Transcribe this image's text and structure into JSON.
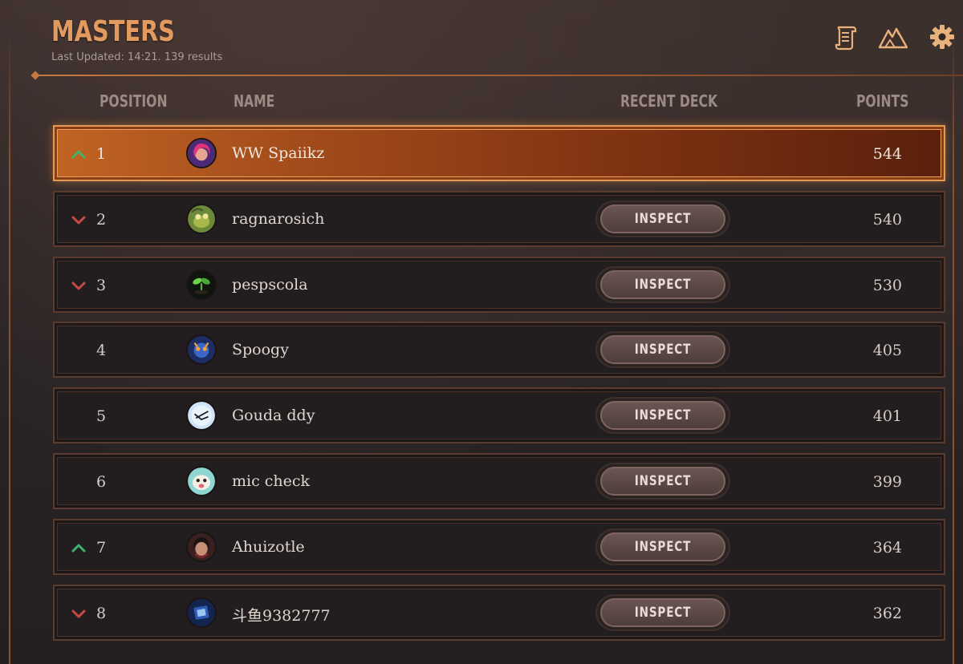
{
  "header": {
    "title": "MASTERS",
    "subtitle": "Last Updated: 14:21. 139 results",
    "icons": [
      "scroll-icon",
      "mountains-icon",
      "gear-icon"
    ]
  },
  "columns": {
    "position": "POSITION",
    "name": "NAME",
    "recent_deck": "RECENT DECK",
    "points": "POINTS"
  },
  "colors": {
    "accent": "#e29a5e",
    "trend_up": "#3fb36a",
    "trend_down": "#c94a44",
    "highlight_row": "#a04a1a"
  },
  "inspect_label": "INSPECT",
  "rows": [
    {
      "position": "1",
      "name": "WW Spaiikz",
      "points": "544",
      "trend": "up",
      "highlighted": true,
      "has_deck": false,
      "avatar": "pink-hair-champion-avatar"
    },
    {
      "position": "2",
      "name": "ragnarosich",
      "points": "540",
      "trend": "down",
      "has_deck": true,
      "avatar": "green-creature-avatar"
    },
    {
      "position": "3",
      "name": "pespscola",
      "points": "530",
      "trend": "down",
      "has_deck": true,
      "avatar": "sprout-avatar"
    },
    {
      "position": "4",
      "name": "Spoogy",
      "points": "405",
      "trend": "none",
      "has_deck": true,
      "avatar": "blue-beast-avatar"
    },
    {
      "position": "5",
      "name": "Gouda ddy",
      "points": "401",
      "trend": "none",
      "has_deck": true,
      "avatar": "blue-sketch-avatar"
    },
    {
      "position": "6",
      "name": "mic check",
      "points": "399",
      "trend": "none",
      "has_deck": true,
      "avatar": "poro-avatar"
    },
    {
      "position": "7",
      "name": "Ahuizotle",
      "points": "364",
      "trend": "up",
      "has_deck": true,
      "avatar": "dark-hair-champion-avatar"
    },
    {
      "position": "8",
      "name": "斗鱼9382777",
      "points": "362",
      "trend": "down",
      "has_deck": true,
      "avatar": "blue-card-avatar"
    }
  ]
}
